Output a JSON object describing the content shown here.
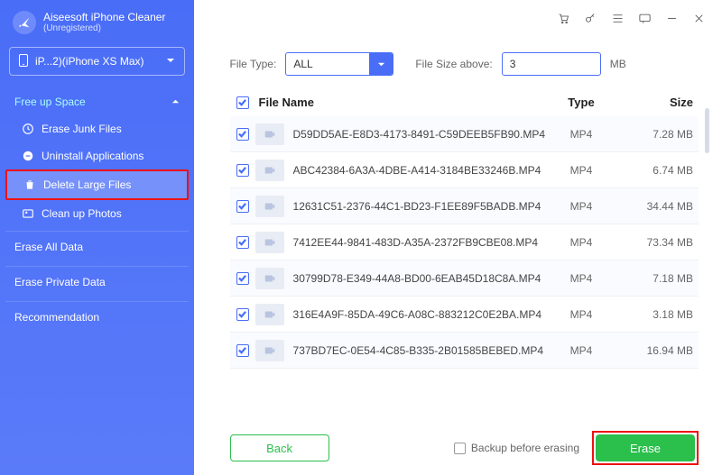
{
  "brand": {
    "title": "Aiseesoft iPhone",
    "subtitle": "Cleaner",
    "status": "(Unregistered)"
  },
  "device": {
    "label": "iP...2)(iPhone XS Max)"
  },
  "sidebar": {
    "free_up_space": "Free up Space",
    "items": [
      {
        "label": "Erase Junk Files"
      },
      {
        "label": "Uninstall Applications"
      },
      {
        "label": "Delete Large Files"
      },
      {
        "label": "Clean up Photos"
      }
    ],
    "erase_all": "Erase All Data",
    "erase_private": "Erase Private Data",
    "recommendation": "Recommendation"
  },
  "filters": {
    "file_type_label": "File Type:",
    "file_type_value": "ALL",
    "file_size_label": "File Size above:",
    "file_size_value": "3",
    "file_size_unit": "MB"
  },
  "columns": {
    "name": "File Name",
    "type": "Type",
    "size": "Size"
  },
  "files": [
    {
      "name": "D59DD5AE-E8D3-4173-8491-C59DEEB5FB90.MP4",
      "type": "MP4",
      "size": "7.28 MB"
    },
    {
      "name": "ABC42384-6A3A-4DBE-A414-3184BE33246B.MP4",
      "type": "MP4",
      "size": "6.74 MB"
    },
    {
      "name": "12631C51-2376-44C1-BD23-F1EE89F5BADB.MP4",
      "type": "MP4",
      "size": "34.44 MB"
    },
    {
      "name": "7412EE44-9841-483D-A35A-2372FB9CBE08.MP4",
      "type": "MP4",
      "size": "73.34 MB"
    },
    {
      "name": "30799D78-E349-44A8-BD00-6EAB45D18C8A.MP4",
      "type": "MP4",
      "size": "7.18 MB"
    },
    {
      "name": "316E4A9F-85DA-49C6-A08C-883212C0E2BA.MP4",
      "type": "MP4",
      "size": "3.18 MB"
    },
    {
      "name": "737BD7EC-0E54-4C85-B335-2B01585BEBED.MP4",
      "type": "MP4",
      "size": "16.94 MB"
    }
  ],
  "footer": {
    "back": "Back",
    "backup_label": "Backup before erasing",
    "erase": "Erase"
  }
}
